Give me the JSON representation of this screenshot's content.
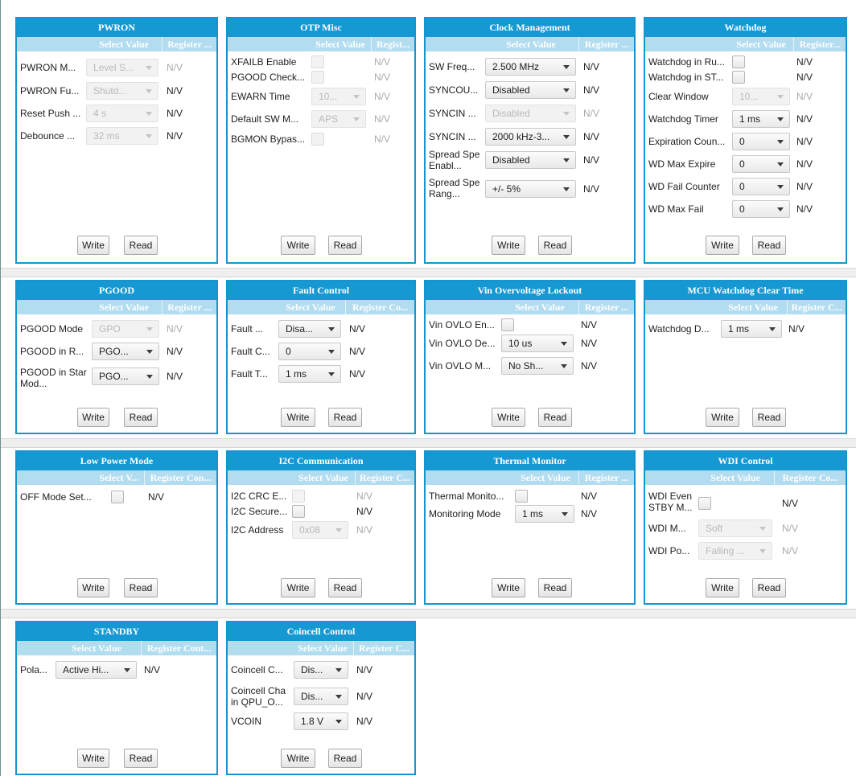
{
  "colors": {
    "header": "#1698d3",
    "subheader": "#b2dcf0",
    "border": "#1595cf"
  },
  "buttons": {
    "write": "Write",
    "read": "Read"
  },
  "pwron": {
    "title": "PWRON",
    "col1": "Select Value",
    "col2": "Register ...",
    "rows": [
      {
        "label": "PWRON M...",
        "value": "Level S...",
        "reg": "N/V"
      },
      {
        "label": "PWRON Fu...",
        "value": "Shutd...",
        "reg": "N/V"
      },
      {
        "label": "Reset Push ...",
        "value": "4 s",
        "reg": "N/V"
      },
      {
        "label": "Debounce ...",
        "value": "32 ms",
        "reg": "N/V"
      }
    ]
  },
  "otp": {
    "title": "OTP Misc",
    "col1": "Select Value",
    "col2": "Regist...",
    "rows": [
      {
        "label": "XFAILB Enable",
        "reg": "N/V"
      },
      {
        "label": "PGOOD Check...",
        "reg": "N/V"
      },
      {
        "label": "EWARN Time",
        "value": "10...",
        "reg": "N/V"
      },
      {
        "label": "Default SW M...",
        "value": "APS",
        "reg": "N/V"
      },
      {
        "label": "BGMON Bypas...",
        "reg": "N/V"
      }
    ]
  },
  "clock": {
    "title": "Clock Management",
    "col1": "Select Value",
    "col2": "Register ...",
    "rows": [
      {
        "label": "SW Freq...",
        "value": "2.500 MHz",
        "reg": "N/V"
      },
      {
        "label": "SYNCOU...",
        "value": "Disabled",
        "reg": "N/V"
      },
      {
        "label": "SYNCIN ...",
        "value": "Disabled",
        "reg": "N/V"
      },
      {
        "label": "SYNCIN ...",
        "value": "2000 kHz-3...",
        "reg": "N/V"
      },
      {
        "label": "Spread Spe Enabl...",
        "value": "Disabled",
        "reg": "N/V"
      },
      {
        "label": "Spread Spe Rang...",
        "value": "+/- 5%",
        "reg": "N/V"
      }
    ]
  },
  "watchdog": {
    "title": "Watchdog",
    "col1": "Select Value",
    "col2": "Register...",
    "rows": [
      {
        "label": "Watchdog in Ru...",
        "reg": "N/V"
      },
      {
        "label": "Watchdog in ST...",
        "reg": "N/V"
      },
      {
        "label": "Clear Window",
        "value": "10...",
        "reg": "N/V"
      },
      {
        "label": "Watchdog Timer",
        "value": "1 ms",
        "reg": "N/V"
      },
      {
        "label": "Expiration Coun...",
        "value": "0",
        "reg": "N/V"
      },
      {
        "label": "WD Max Expire",
        "value": "0",
        "reg": "N/V"
      },
      {
        "label": "WD Fail Counter",
        "value": "0",
        "reg": "N/V"
      },
      {
        "label": "WD Max Fail",
        "value": "0",
        "reg": "N/V"
      }
    ]
  },
  "pgood": {
    "title": "PGOOD",
    "col1": "Select Value",
    "col2": "Register ...",
    "rows": [
      {
        "label": "PGOOD Mode",
        "value": "GPO",
        "reg": "N/V"
      },
      {
        "label": "PGOOD in R...",
        "value": "PGO...",
        "reg": "N/V"
      },
      {
        "label": "PGOOD in Star Mod...",
        "value": "PGO...",
        "reg": "N/V"
      }
    ]
  },
  "fault": {
    "title": "Fault Control",
    "col1": "Select Value",
    "col2": "Register Co...",
    "rows": [
      {
        "label": "Fault ...",
        "value": "Disa...",
        "reg": "N/V"
      },
      {
        "label": "Fault C...",
        "value": "0",
        "reg": "N/V"
      },
      {
        "label": "Fault T...",
        "value": "1 ms",
        "reg": "N/V"
      }
    ]
  },
  "vin": {
    "title": "Vin Overvoltage Lockout",
    "col1": "Select Value",
    "col2": "Register ...",
    "rows": [
      {
        "label": "Vin OVLO En...",
        "reg": "N/V"
      },
      {
        "label": "Vin OVLO De...",
        "value": "10 us",
        "reg": "N/V"
      },
      {
        "label": "Vin OVLO M...",
        "value": "No Sh...",
        "reg": "N/V"
      }
    ]
  },
  "mcu": {
    "title": "MCU Watchdog Clear Time",
    "col1": "Select Value",
    "col2": "Register C...",
    "rows": [
      {
        "label": "Watchdog D...",
        "value": "1 ms",
        "reg": "N/V"
      }
    ]
  },
  "lowpower": {
    "title": "Low Power Mode",
    "col1": "Select V...",
    "col2": "Register Con...",
    "rows": [
      {
        "label": "OFF Mode Set...",
        "reg": "N/V"
      }
    ]
  },
  "i2c": {
    "title": "I2C Communication",
    "col1": "Select Value",
    "col2": "Register C...",
    "rows": [
      {
        "label": "I2C CRC E...",
        "reg": "N/V"
      },
      {
        "label": "I2C Secure...",
        "reg": "N/V"
      },
      {
        "label": "I2C Address",
        "value": "0x08",
        "reg": "N/V"
      }
    ]
  },
  "thermal": {
    "title": "Thermal Monitor",
    "col1": "Select Value",
    "col2": "Register ...",
    "rows": [
      {
        "label": "Thermal Monito...",
        "reg": "N/V"
      },
      {
        "label": "Monitoring Mode",
        "value": "1 ms",
        "reg": "N/V"
      }
    ]
  },
  "wdi": {
    "title": "WDI Control",
    "col1": "Select Value",
    "col2": "Register Co...",
    "rows": [
      {
        "label": "WDI Even STBY M...",
        "reg": "N/V"
      },
      {
        "label": "WDI M...",
        "value": "Soft",
        "reg": "N/V"
      },
      {
        "label": "WDI Po...",
        "value": "Falling ...",
        "reg": "N/V"
      }
    ]
  },
  "standby": {
    "title": "STANDBY",
    "col1": "Select Value",
    "col2": "Register Cont...",
    "rows": [
      {
        "label": "Pola...",
        "value": "Active Hi...",
        "reg": "N/V"
      }
    ]
  },
  "coincell": {
    "title": "Coincell Control",
    "col1": "Select Value",
    "col2": "Register C...",
    "rows": [
      {
        "label": "Coincell C...",
        "value": "Dis...",
        "reg": "N/V"
      },
      {
        "label": "Coincell Cha in QPU_O...",
        "value": "Dis...",
        "reg": "N/V"
      },
      {
        "label": "VCOIN",
        "value": "1.8 V",
        "reg": "N/V"
      }
    ]
  }
}
